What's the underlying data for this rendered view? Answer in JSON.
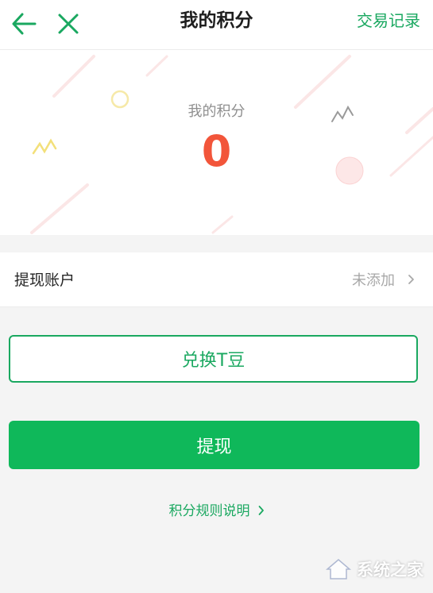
{
  "header": {
    "title": "我的积分",
    "right_link": "交易记录",
    "back_icon": "arrow-left-icon",
    "close_icon": "close-icon"
  },
  "points": {
    "label": "我的积分",
    "value": "0"
  },
  "account": {
    "label": "提现账户",
    "status": "未添加"
  },
  "buttons": {
    "exchange": "兑换T豆",
    "withdraw": "提现"
  },
  "rules_link": "积分规则说明",
  "watermark": {
    "text": "系统之家"
  },
  "colors": {
    "accent_green": "#1aa860",
    "button_green": "#0fb85a",
    "points_red": "#f2553a"
  }
}
